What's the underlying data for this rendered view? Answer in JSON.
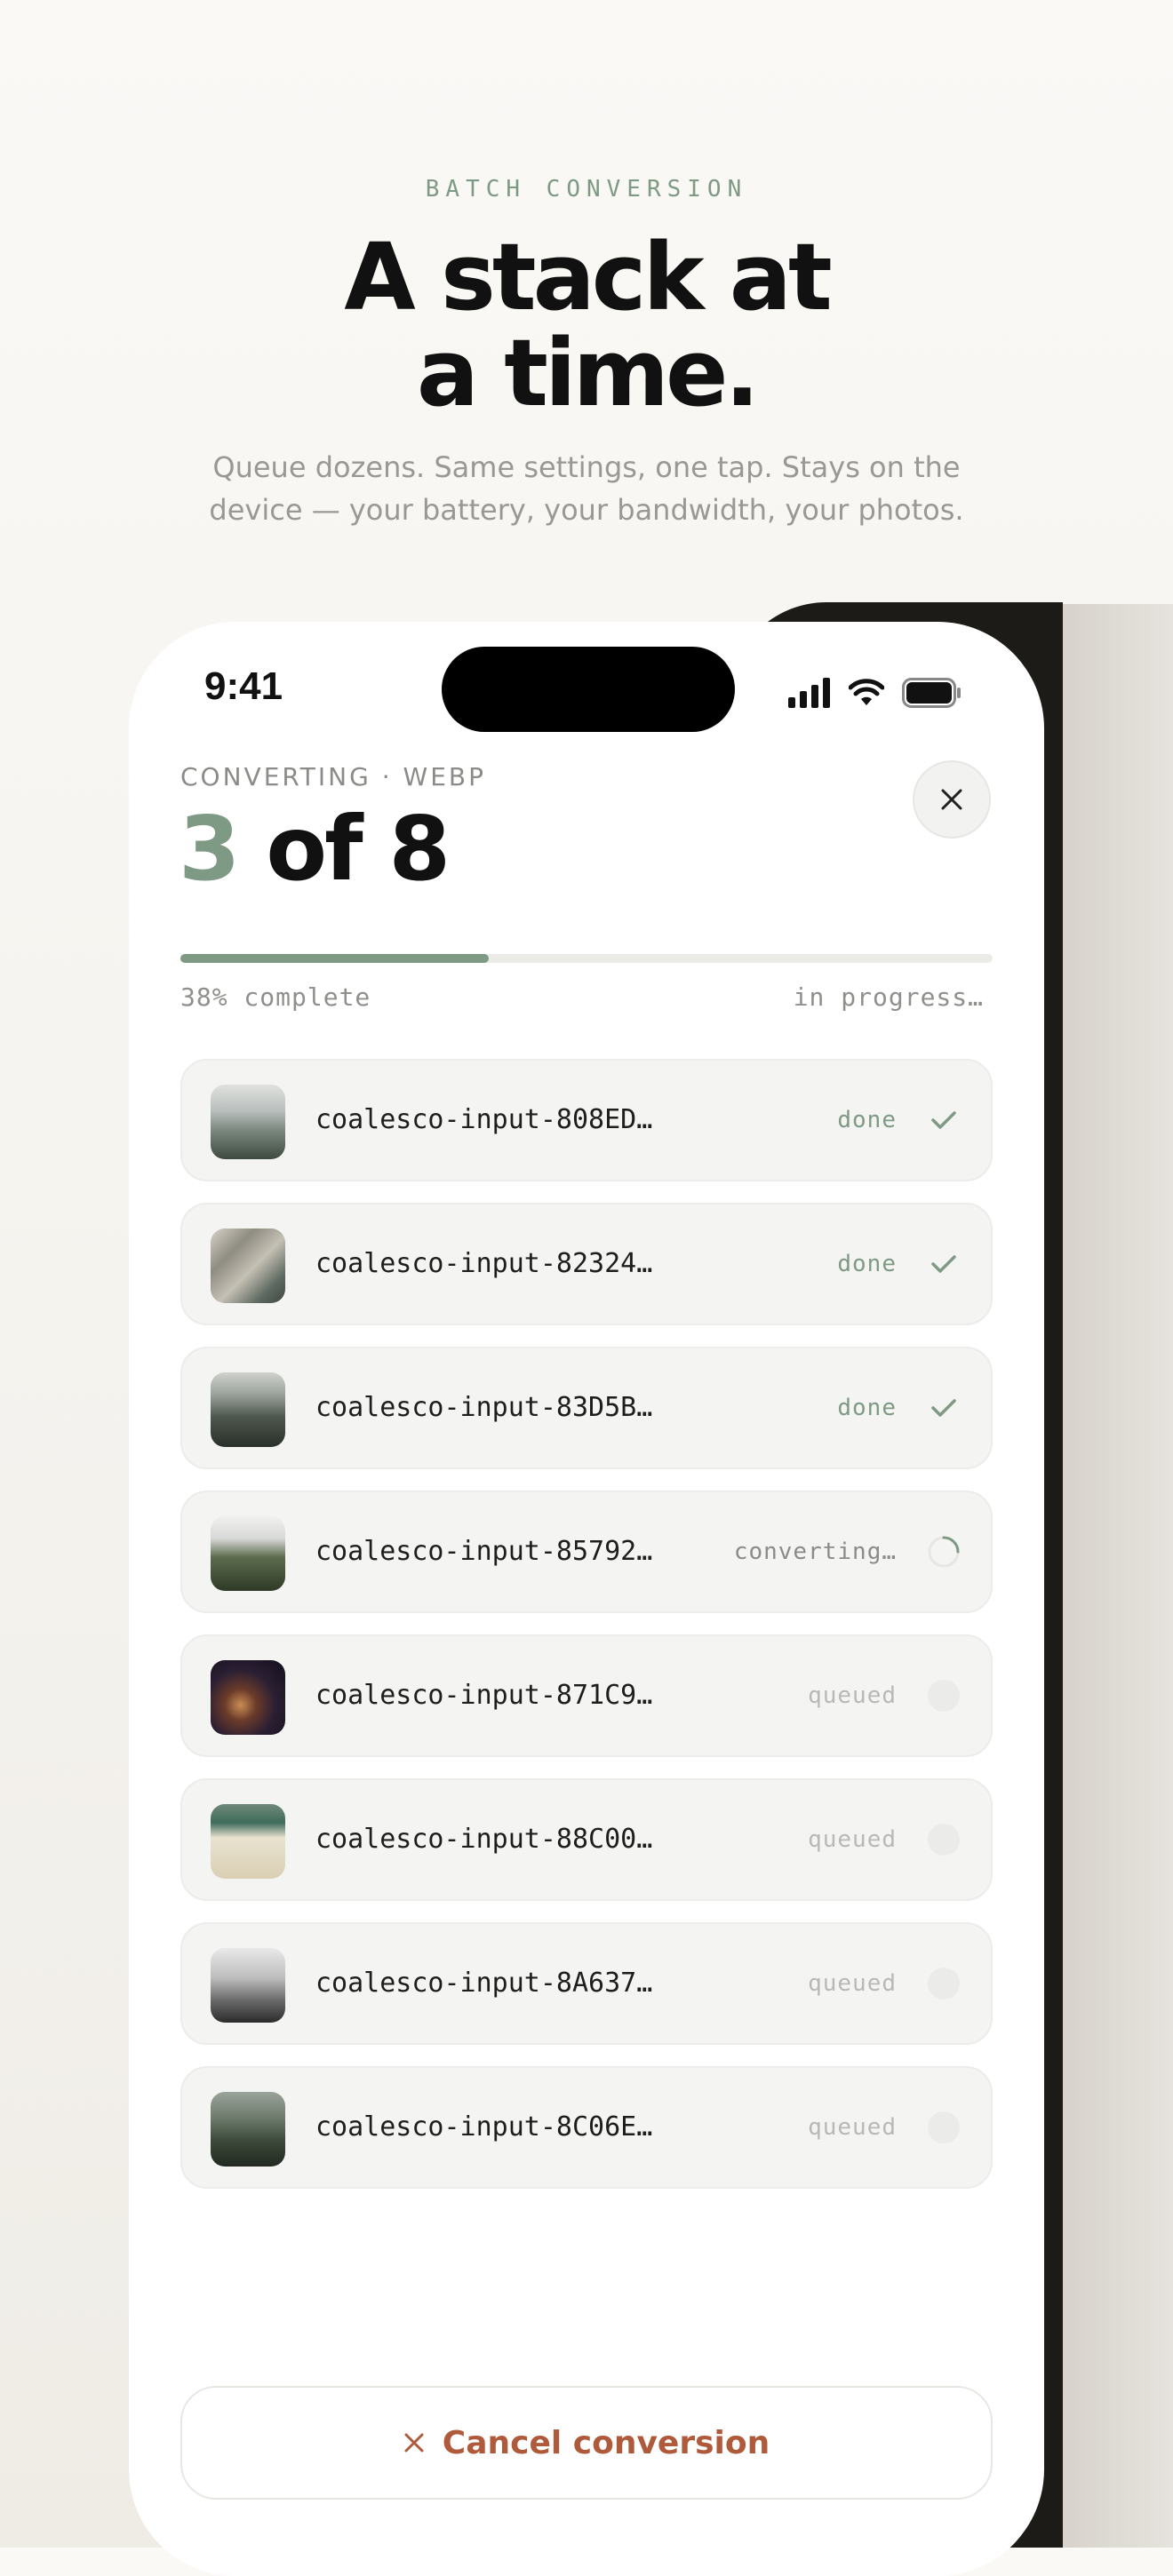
{
  "hero": {
    "eyebrow": "BATCH CONVERSION",
    "headline_line1": "A stack at",
    "headline_line2": "a time.",
    "subline": "Queue dozens. Same settings, one tap. Stays on the device — your battery, your bandwidth, your photos."
  },
  "status_bar": {
    "time": "9:41",
    "icons": [
      "cellular-signal-icon",
      "wifi-icon",
      "battery-icon"
    ]
  },
  "header": {
    "label": "CONVERTING · WEBP",
    "current": "3",
    "of_total": "of 8",
    "close_icon": "close-icon"
  },
  "progress": {
    "fraction": 0.38,
    "percent_text": "38% complete",
    "state_text": "in progress…"
  },
  "files": [
    {
      "name": "coalesco-input-808ED…",
      "state": "done",
      "status": "done"
    },
    {
      "name": "coalesco-input-82324…",
      "state": "done",
      "status": "done"
    },
    {
      "name": "coalesco-input-83D5B…",
      "state": "done",
      "status": "done"
    },
    {
      "name": "coalesco-input-85792…",
      "state": "converting…",
      "status": "converting"
    },
    {
      "name": "coalesco-input-871C9…",
      "state": "queued",
      "status": "queued"
    },
    {
      "name": "coalesco-input-88C00…",
      "state": "queued",
      "status": "queued"
    },
    {
      "name": "coalesco-input-8A637…",
      "state": "queued",
      "status": "queued"
    },
    {
      "name": "coalesco-input-8C06E…",
      "state": "queued",
      "status": "queued"
    }
  ],
  "cancel": {
    "label": "Cancel conversion",
    "icon": "close-icon"
  },
  "colors": {
    "accent": "#7e9a84",
    "danger": "#b05a3c",
    "ink": "#111111"
  }
}
